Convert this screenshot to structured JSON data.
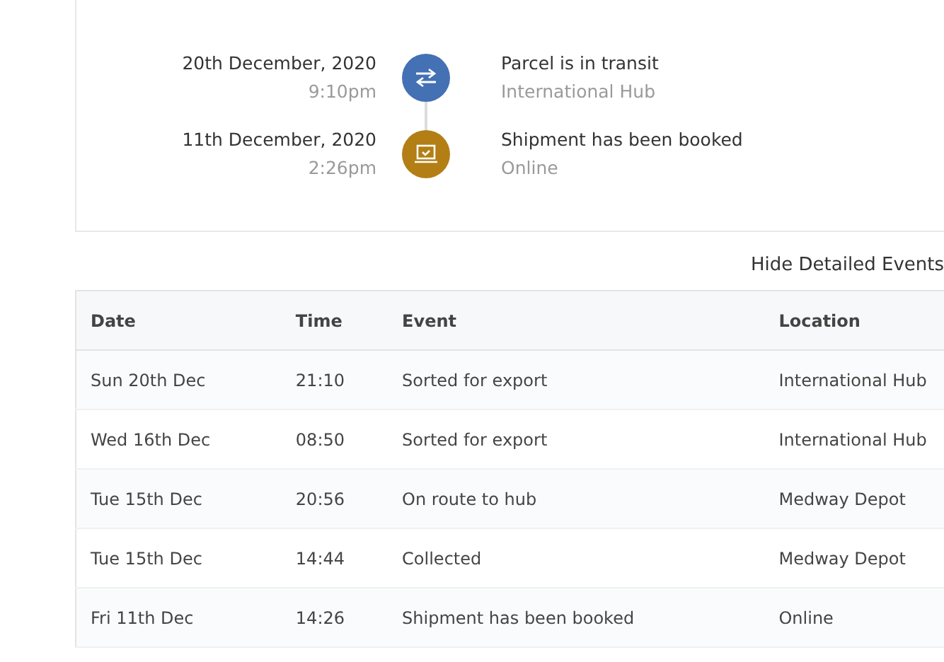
{
  "timeline": [
    {
      "date": "20th December, 2020",
      "time": "9:10pm",
      "title": "Parcel is in transit",
      "location": "International Hub",
      "kind": "transit",
      "color": "#4470b4"
    },
    {
      "date": "11th December, 2020",
      "time": "2:26pm",
      "title": "Shipment has been booked",
      "location": "Online",
      "kind": "booked",
      "color": "#b37f14"
    }
  ],
  "toggle_link": "Hide Detailed Events",
  "table": {
    "columns": [
      "Date",
      "Time",
      "Event",
      "Location"
    ],
    "rows": [
      [
        "Sun 20th Dec",
        "21:10",
        "Sorted for export",
        "International Hub"
      ],
      [
        "Wed 16th Dec",
        "08:50",
        "Sorted for export",
        "International Hub"
      ],
      [
        "Tue 15th Dec",
        "20:56",
        "On route to hub",
        "Medway Depot"
      ],
      [
        "Tue 15th Dec",
        "14:44",
        "Collected",
        "Medway Depot"
      ],
      [
        "Fri 11th Dec",
        "14:26",
        "Shipment has been booked",
        "Online"
      ]
    ]
  }
}
